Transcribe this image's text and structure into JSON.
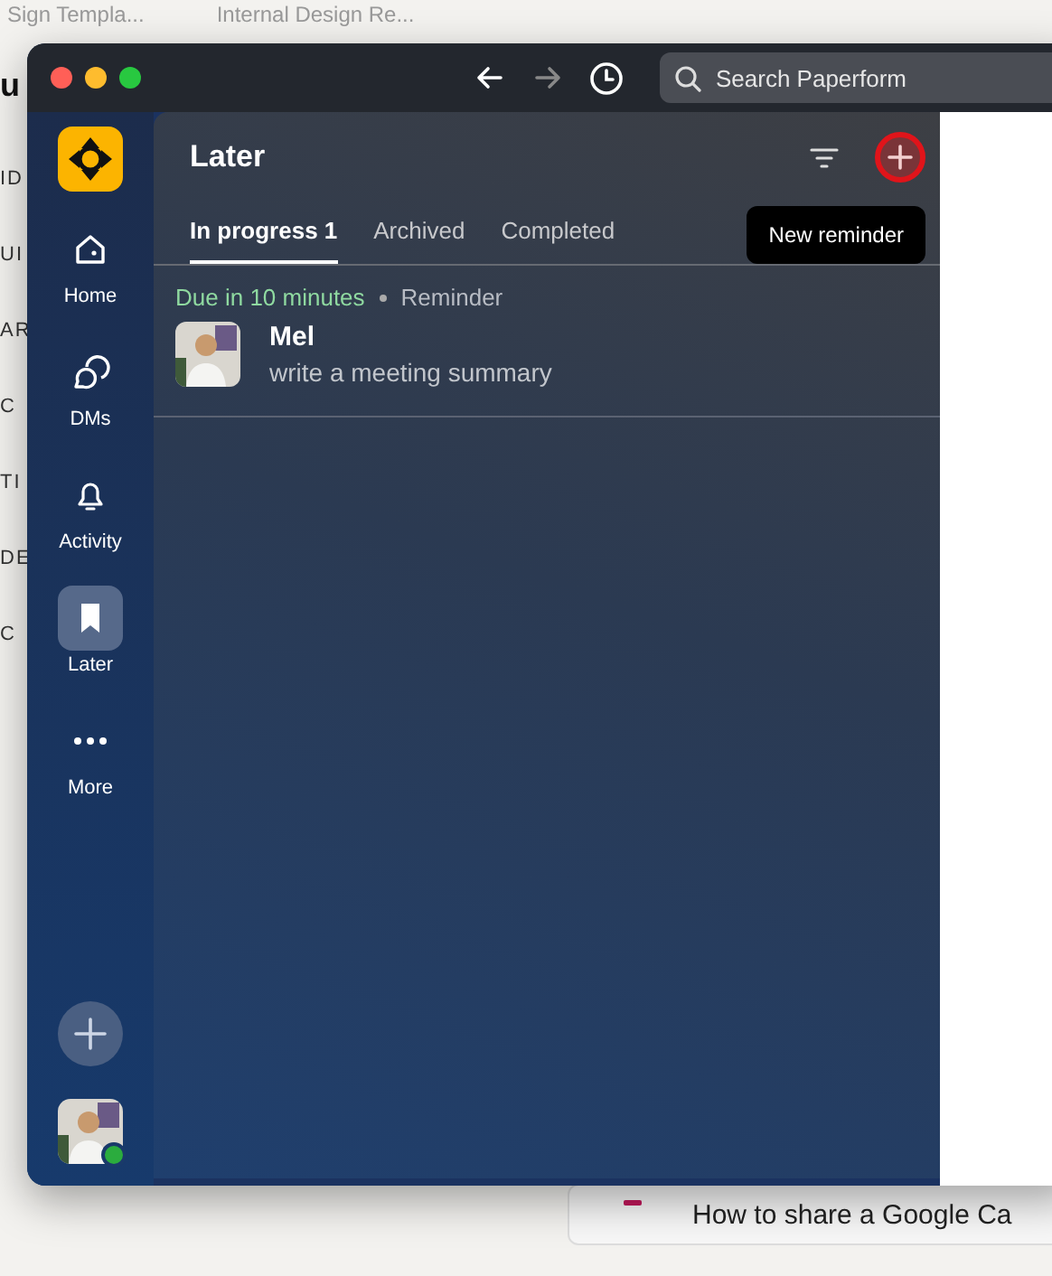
{
  "background": {
    "tabs": [
      "Sign Templa...",
      "Internal Design Re..."
    ],
    "edge_texts": [
      "u",
      "ID",
      "UI",
      "AR",
      "C",
      "TI",
      "DE",
      "C"
    ],
    "bottom_item": {
      "title": "How to share a Google Ca"
    }
  },
  "window": {
    "search": {
      "placeholder": "Search Paperform"
    }
  },
  "sidebar": {
    "items": [
      {
        "label": "Home",
        "selected": false
      },
      {
        "label": "DMs",
        "selected": false
      },
      {
        "label": "Activity",
        "selected": false
      },
      {
        "label": "Later",
        "selected": true
      },
      {
        "label": "More",
        "selected": false
      }
    ],
    "user": {
      "online": true
    }
  },
  "panel": {
    "title": "Later",
    "tooltip": "New reminder",
    "tabs": [
      {
        "label": "In progress",
        "count": "1",
        "selected": true
      },
      {
        "label": "Archived",
        "selected": false
      },
      {
        "label": "Completed",
        "selected": false
      }
    ],
    "items": [
      {
        "due": "Due in 10 minutes",
        "type": "Reminder",
        "name": "Mel",
        "text": "write a meeting summary"
      }
    ]
  }
}
